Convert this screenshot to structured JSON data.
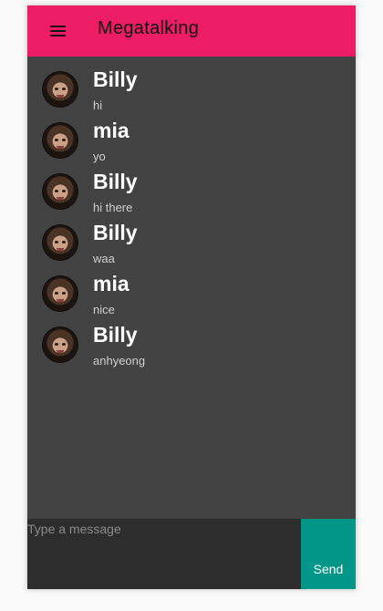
{
  "toolbar": {
    "title": "Megatalking",
    "menu_icon": "menu-icon",
    "background": "#ec1c65"
  },
  "messages": [
    {
      "sender": "Billy",
      "text": "hi"
    },
    {
      "sender": "mia",
      "text": "yo"
    },
    {
      "sender": "Billy",
      "text": "hi there"
    },
    {
      "sender": "Billy",
      "text": "waa"
    },
    {
      "sender": "mia",
      "text": "nice"
    },
    {
      "sender": "Billy",
      "text": "anhyeong"
    }
  ],
  "composer": {
    "placeholder": "Type a message",
    "value": "",
    "send_label": "Send",
    "send_color": "#009688"
  },
  "colors": {
    "chat_background": "#424242",
    "page_background": "#fafafa"
  }
}
